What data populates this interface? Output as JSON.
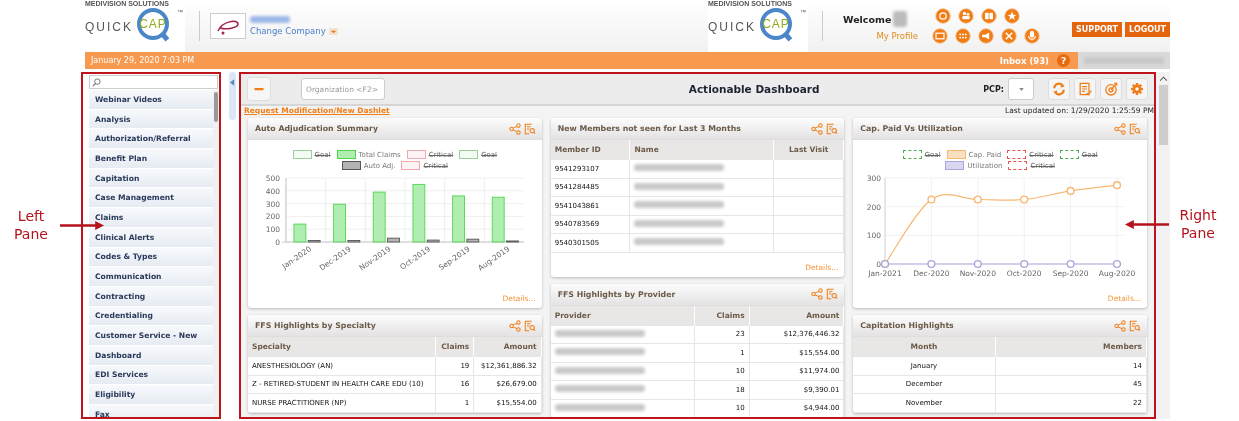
{
  "header": {
    "logo": {
      "maker": "MEDIVISION SOLUTIONS",
      "word1": "QUICK",
      "word2": "CAP",
      "mark": "™"
    },
    "change_company": "Change Company",
    "right_logo": {
      "maker": "MEDIVISION SOLUTIONS",
      "word1": "QUICK",
      "word2": "CAP",
      "mark": "™"
    },
    "welcome": "Welcome",
    "my_profile": "My Profile",
    "buttons": [
      "SUPPORT",
      "LOGOUT"
    ]
  },
  "status_bar": {
    "datetime": "January 29, 2020 7:03 PM",
    "inbox": "Inbox (93)",
    "help": "?"
  },
  "sidebar": {
    "items": [
      {
        "label": "Webinar Videos"
      },
      {
        "label": "Analysis"
      },
      {
        "label": "Authorization/Referral"
      },
      {
        "label": "Benefit Plan"
      },
      {
        "label": "Capitation"
      },
      {
        "label": "Case Management"
      },
      {
        "label": "Claims"
      },
      {
        "label": "Clinical Alerts"
      },
      {
        "label": "Codes & Types"
      },
      {
        "label": "Communication"
      },
      {
        "label": "Contracting"
      },
      {
        "label": "Credentialing"
      },
      {
        "label": "Customer Service - New"
      },
      {
        "label": "Dashboard"
      },
      {
        "label": "EDI Services"
      },
      {
        "label": "Eligibility"
      },
      {
        "label": "Fax"
      }
    ]
  },
  "toolbar": {
    "organization": {
      "placeholder": "Organization <F2>"
    },
    "title": "Actionable Dashboard",
    "pcp_label": "PCP:"
  },
  "request_link": "Request Modification/New Dashlet",
  "last_updated": "Last updated on: 1/29/2020 1:25:59 PM",
  "columns": [
    {
      "cards": [
        {
          "kind": "chart",
          "title": "Auto Adjudication Summary",
          "details": "Details...",
          "legend": [
            {
              "label": "Goal",
              "color": "#9ccf9c",
              "hidden": true
            },
            {
              "kind": "series"
            },
            {
              "label": "Critical",
              "color": "#f2a6ae",
              "hidden": true
            },
            {
              "label": "Goal",
              "color": "#9ccf9c",
              "hidden": true
            },
            {
              "kind": "series"
            },
            {
              "label": "Critical",
              "color": "#f2a6ae",
              "hidden": true
            }
          ],
          "chart_data": {
            "type": "bar",
            "grid": true,
            "categories": [
              "Jan-2020",
              "Dec-2019",
              "Nov-2019",
              "Oct-2019",
              "Sep-2019",
              "Aug-2019"
            ],
            "ylim": [
              0,
              500
            ],
            "yticks": [
              0,
              100,
              200,
              300,
              400,
              500
            ],
            "series": [
              {
                "name": "Total Claims",
                "color": "#4fd64f",
                "values": [
                  140,
                  295,
                  390,
                  450,
                  360,
                  350
                ]
              },
              {
                "name": "Auto Adj.",
                "color": "#555555",
                "values": [
                  12,
                  12,
                  30,
                  15,
                  22,
                  8
                ]
              }
            ]
          }
        },
        {
          "kind": "table",
          "title": "FFS Highlights by Specialty",
          "columns": [
            {
              "label": "Specialty",
              "kind": "text"
            },
            {
              "label": "Claims",
              "kind": "number"
            },
            {
              "label": "Amount",
              "kind": "number"
            }
          ],
          "rows": [
            [
              "ANESTHESIOLOGY (AN)",
              "19",
              "$12,361,886.32"
            ],
            [
              "Z - RETIRED-STUDENT IN HEALTH CARE EDU (10)",
              "16",
              "$26,679.00"
            ],
            [
              "NURSE PRACTITIONER (NP)",
              "1",
              "$15,554.00"
            ]
          ]
        }
      ]
    },
    {
      "cards": [
        {
          "kind": "table",
          "title": "New Members not seen for Last 3 Months",
          "details": "Details...",
          "columns": [
            {
              "label": "Member ID",
              "kind": "text"
            },
            {
              "label": "Name",
              "kind": "text"
            },
            {
              "label": "Last Visit",
              "kind": "date"
            }
          ],
          "rows": [
            [
              "9541293107",
              {
                "redacted": true
              }
            ],
            [
              "9541284485",
              {
                "redacted": true
              }
            ],
            [
              "9541043861",
              {
                "redacted": true
              }
            ],
            [
              "9540783569",
              {
                "redacted": true
              }
            ],
            [
              "9540301505",
              {
                "redacted": true
              }
            ]
          ]
        },
        {
          "kind": "table",
          "title": "FFS Highlights by Provider",
          "columns": [
            {
              "label": "Provider",
              "kind": "text"
            },
            {
              "label": "Claims",
              "kind": "number"
            },
            {
              "label": "Amount",
              "kind": "number"
            }
          ],
          "rows": [
            [
              {
                "redacted": true
              },
              "23",
              "$12,376,446.32"
            ],
            [
              {
                "redacted": true
              },
              "1",
              "$15,554.00"
            ],
            [
              {
                "redacted": true
              },
              "10",
              "$11,974.00"
            ],
            [
              {
                "redacted": true
              },
              "18",
              "$9,390.01"
            ],
            [
              {
                "redacted": true
              },
              "10",
              "$4,944.00"
            ]
          ]
        }
      ]
    },
    {
      "cards": [
        {
          "kind": "chart",
          "title": "Cap. Paid Vs Utilization",
          "details": "Details...",
          "legend": [
            {
              "label": "Goal",
              "color": "#4caf50",
              "hidden": true
            },
            {
              "kind": "series"
            },
            {
              "label": "Critical",
              "color": "#ef5350",
              "hidden": true
            },
            {
              "label": "Goal",
              "color": "#4caf50",
              "hidden": true
            },
            {
              "kind": "series"
            },
            {
              "label": "Critical",
              "color": "#ef5350",
              "hidden": true
            }
          ],
          "chart_data": {
            "type": "line",
            "grid": true,
            "categories": [
              "Jan-2021",
              "Dec-2020",
              "Nov-2020",
              "Oct-2020",
              "Sep-2020",
              "Aug-2020"
            ],
            "ylim": [
              0,
              300
            ],
            "yticks": [
              0,
              100,
              200,
              300
            ],
            "series": [
              {
                "name": "Cap. Paid",
                "color": "#f9b774",
                "marker": "circle",
                "values": [
                  0,
                  225,
                  225,
                  225,
                  255,
                  275
                ]
              },
              {
                "name": "Utilization",
                "color": "#aaa6dc",
                "marker": "circle",
                "values": [
                  0,
                  0,
                  0,
                  0,
                  0,
                  0
                ]
              }
            ]
          }
        },
        {
          "kind": "table",
          "title": "Capitation Highlights",
          "columns": [
            {
              "label": "Month",
              "kind": "date"
            },
            {
              "label": "Members",
              "kind": "number"
            }
          ],
          "rows": [
            [
              "January",
              "14"
            ],
            [
              "December",
              "45"
            ],
            [
              "November",
              "22"
            ]
          ]
        }
      ]
    }
  ],
  "callouts": [
    {
      "text": "Left Pane",
      "kind": "left"
    },
    {
      "text": "Right Pane",
      "kind": "right"
    }
  ]
}
